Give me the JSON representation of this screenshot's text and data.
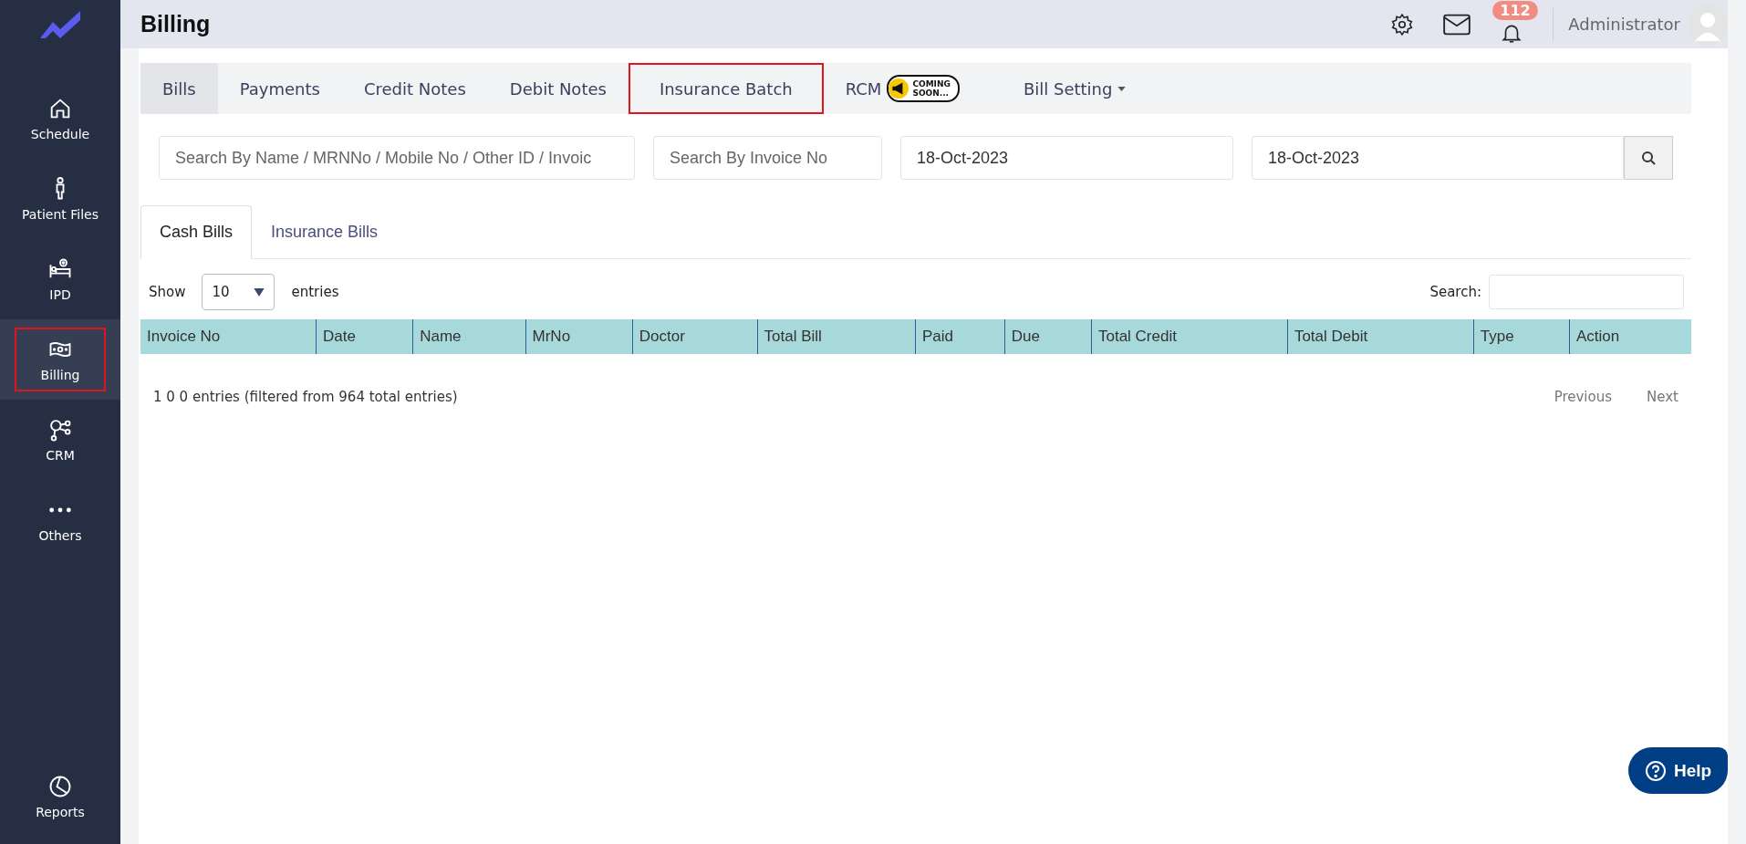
{
  "sidebar": {
    "items": [
      {
        "label": "Schedule",
        "selected": false,
        "highlighted": false
      },
      {
        "label": "Patient Files",
        "selected": false,
        "highlighted": false
      },
      {
        "label": "IPD",
        "selected": false,
        "highlighted": false
      },
      {
        "label": "Billing",
        "selected": true,
        "highlighted": true
      },
      {
        "label": "CRM",
        "selected": false,
        "highlighted": false
      },
      {
        "label": "Others",
        "selected": false,
        "highlighted": false
      }
    ],
    "bottom_item": {
      "label": "Reports"
    }
  },
  "header": {
    "title": "Billing",
    "notification_count": "112",
    "user": "Administrator"
  },
  "tabs": [
    {
      "label": "Bills",
      "selected": true,
      "highlighted": false,
      "kind": "plain"
    },
    {
      "label": "Payments",
      "selected": false,
      "highlighted": false,
      "kind": "plain"
    },
    {
      "label": "Credit Notes",
      "selected": false,
      "highlighted": false,
      "kind": "plain"
    },
    {
      "label": "Debit Notes",
      "selected": false,
      "highlighted": false,
      "kind": "plain"
    },
    {
      "label": "Insurance Batch",
      "selected": false,
      "highlighted": true,
      "kind": "plain"
    },
    {
      "label": "RCM",
      "selected": false,
      "highlighted": false,
      "kind": "badge",
      "badge_lines": [
        "COMING",
        "SOON..."
      ]
    },
    {
      "label": "Bill Setting",
      "selected": false,
      "highlighted": false,
      "kind": "dropdown"
    }
  ],
  "filters": {
    "name_placeholder": "Search By Name / MRNNo / Mobile No / Other ID / Invoic",
    "invoice_placeholder": "Search By Invoice No",
    "from_date": "18-Oct-2023",
    "to_date": "18-Oct-2023"
  },
  "sub_tabs": [
    {
      "label": "Cash Bills",
      "selected": true
    },
    {
      "label": "Insurance Bills",
      "selected": false
    }
  ],
  "table": {
    "show_label": "Show",
    "page_size": "10",
    "entries_label": "entries",
    "search_label": "Search:",
    "columns": [
      "Invoice No",
      "Date",
      "Name",
      "MrNo",
      "Doctor",
      "Total Bill",
      "Paid",
      "Due",
      "Total Credit",
      "Total Debit",
      "Type",
      "Action"
    ],
    "info": "1 0 0 entries (filtered from 964 total entries)",
    "previous": "Previous",
    "next": "Next"
  },
  "help_button": "Help"
}
